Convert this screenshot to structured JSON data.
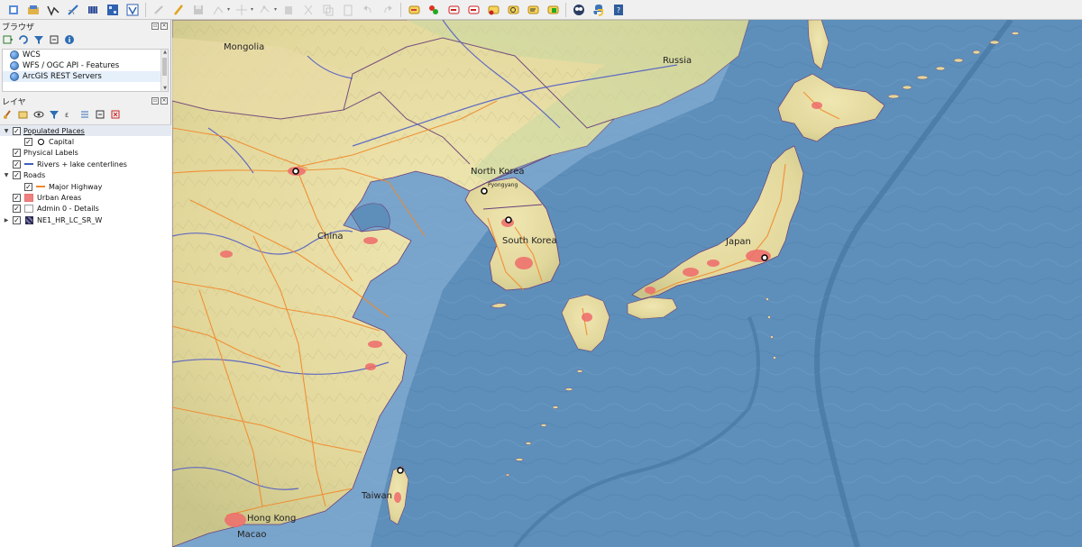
{
  "toolbar": {
    "groups": [
      [
        "new-project-icon",
        "open-data-icon",
        "open-vector-icon",
        "digitize-icon",
        "grid-icon",
        "raster-icon",
        "virtual-layer-icon"
      ],
      [
        "edit-pencil-icon",
        "toggle-edit-icon",
        "save-edits-icon",
        "add-feature-icon",
        "move-icon",
        "node-tool-icon",
        "delete-icon",
        "cut-icon",
        "copy-icon",
        "paste-icon",
        "undo-icon",
        "redo-icon"
      ],
      [
        "label-tool-icon",
        "label-pin-icon",
        "label-highlight-icon",
        "label-visibility-icon",
        "label-move-icon",
        "label-rotate-icon",
        "label-change-icon",
        "label-options-icon"
      ],
      [
        "plugin-globe-icon",
        "python-icon",
        "help-icon"
      ]
    ]
  },
  "browser": {
    "title": "ブラウザ",
    "items": [
      {
        "label": "WCS",
        "icon": "wcs-icon"
      },
      {
        "label": "WFS / OGC API - Features",
        "icon": "wfs-icon"
      },
      {
        "label": "ArcGIS REST Servers",
        "icon": "arcgis-icon"
      }
    ]
  },
  "layers": {
    "title": "レイヤ",
    "items": [
      {
        "label": "Populated Places",
        "checked": true,
        "expander": "▼",
        "indent": 0,
        "symbol": "none",
        "style": "underline"
      },
      {
        "label": "Capital",
        "checked": true,
        "expander": "",
        "indent": 1,
        "symbol": "circle"
      },
      {
        "label": "Physical Labels",
        "checked": true,
        "expander": "",
        "indent": 0,
        "symbol": "none"
      },
      {
        "label": "Rivers + lake centerlines",
        "checked": true,
        "expander": "",
        "indent": 0,
        "symbol": "line-blue"
      },
      {
        "label": "Roads",
        "checked": true,
        "expander": "▼",
        "indent": 0,
        "symbol": "none"
      },
      {
        "label": "Major Highway",
        "checked": true,
        "expander": "",
        "indent": 1,
        "symbol": "line-orange"
      },
      {
        "label": "Urban Areas",
        "checked": true,
        "expander": "",
        "indent": 0,
        "symbol": "fill-red"
      },
      {
        "label": "Admin 0 - Details",
        "checked": true,
        "expander": "",
        "indent": 0,
        "symbol": "fill-white"
      },
      {
        "label": "NE1_HR_LC_SR_W",
        "checked": true,
        "expander": "▶",
        "indent": 0,
        "symbol": "raster"
      }
    ]
  },
  "map": {
    "countries": [
      "Mongolia",
      "Russia",
      "China",
      "North Korea",
      "South Korea",
      "Japan",
      "Taiwan"
    ],
    "cities": [
      "Pyongyang",
      "Hong Kong",
      "Macao"
    ],
    "colors": {
      "sea": "#5d8fba",
      "land": "#efe6b1",
      "road": "#f0892a",
      "river": "#4a57c6",
      "urban": "#ef6b6b",
      "border": "#6b3f7a"
    }
  }
}
